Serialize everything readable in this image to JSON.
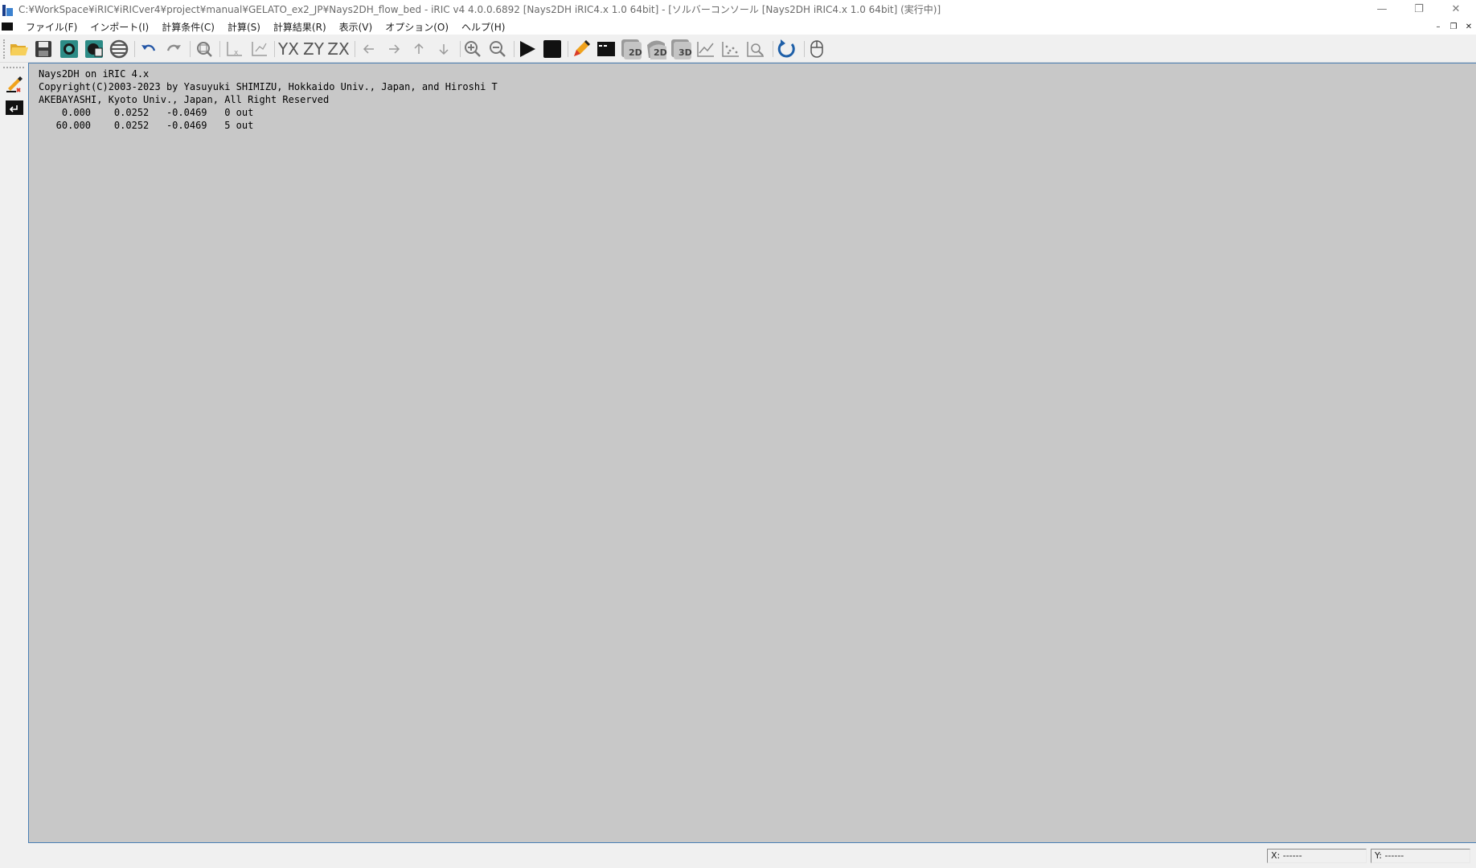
{
  "window": {
    "title": "C:¥WorkSpace¥iRIC¥iRICver4¥project¥manual¥GELATO_ex2_JP¥Nays2DH_flow_bed - iRIC v4 4.0.0.6892 [Nays2DH iRIC4.x 1.0 64bit] - [ソルバーコンソール [Nays2DH iRIC4.x 1.0 64bit] (実行中)]",
    "minimize_glyph": "—",
    "restore_glyph": "❐",
    "close_glyph": "✕"
  },
  "menu": {
    "items": [
      "ファイル(F)",
      "インポート(I)",
      "計算条件(C)",
      "計算(S)",
      "計算結果(R)",
      "表示(V)",
      "オプション(O)",
      "ヘルプ(H)"
    ],
    "mdi_minimize": "–",
    "mdi_restore": "❐",
    "mdi_close": "✕"
  },
  "toolbar": {
    "view_2d_label": "2D",
    "view_2d_b_label": "2D",
    "view_3d_label": "3D",
    "yx_label": "YX",
    "zy_label": "ZY",
    "zx_label": "ZX"
  },
  "console": {
    "lines": [
      "Nays2DH on iRIC 4.x",
      "Copyright(C)2003-2023 by Yasuyuki SHIMIZU, Hokkaido Univ., Japan, and Hiroshi T",
      "AKEBAYASHI, Kyoto Univ., Japan, All Right Reserved",
      "    0.000    0.0252   -0.0469   0 out",
      "   60.000    0.0252   -0.0469   5 out"
    ]
  },
  "status": {
    "x_label": "X: ------",
    "y_label": "Y: ------"
  },
  "colors": {
    "console_background": "#c8c8c8",
    "console_border": "#4a7fb4",
    "accent_blue": "#1e5fa8"
  }
}
